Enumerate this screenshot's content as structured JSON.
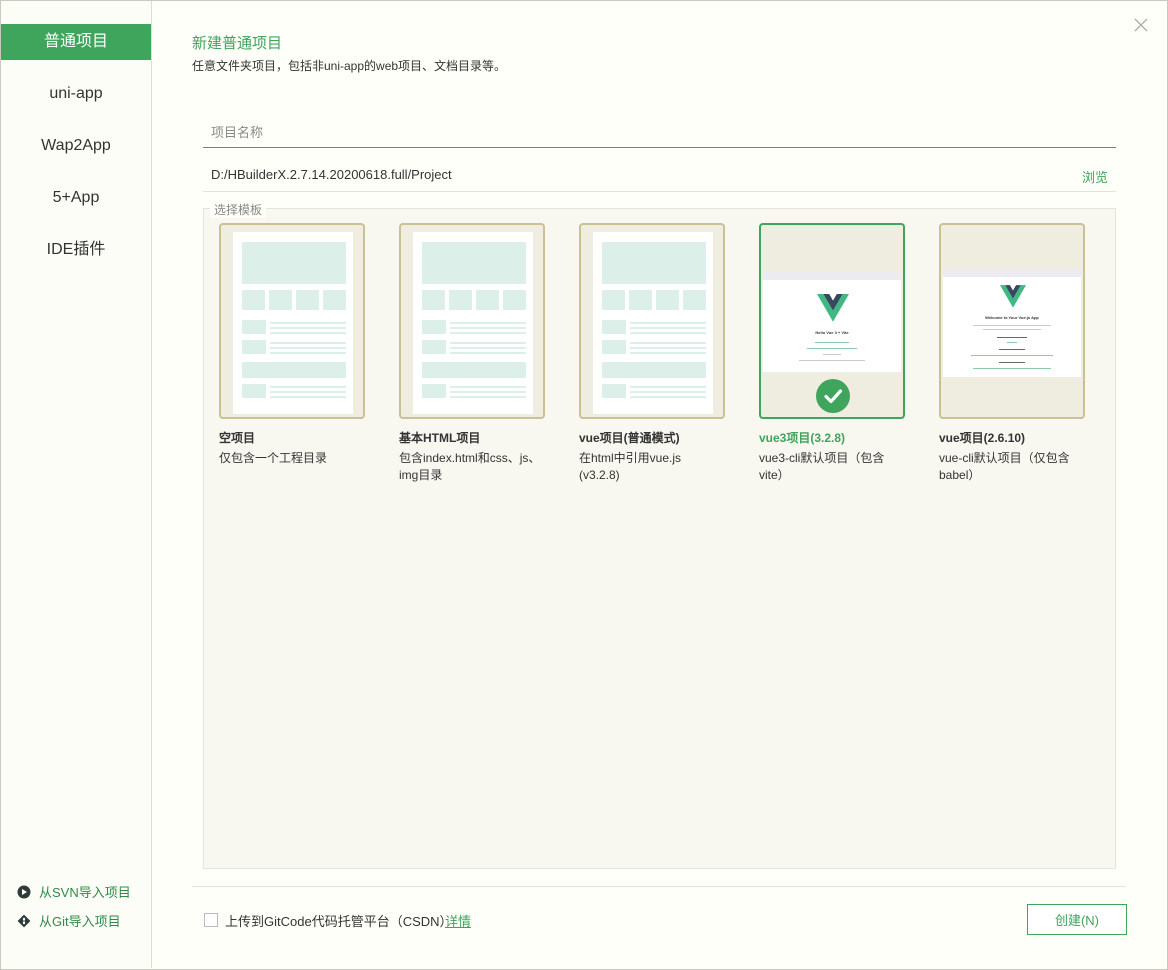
{
  "sidebar": {
    "items": [
      {
        "label": "普通项目"
      },
      {
        "label": "uni-app"
      },
      {
        "label": "Wap2App"
      },
      {
        "label": "5+App"
      },
      {
        "label": "IDE插件"
      }
    ],
    "import_svn": "从SVN导入项目",
    "import_git": "从Git导入项目"
  },
  "header": {
    "title": "新建普通项目",
    "subtitle": "任意文件夹项目，包括非uni-app的web项目、文档目录等。"
  },
  "form": {
    "name_placeholder": "项目名称",
    "name_value": "",
    "path": "D:/HBuilderX.2.7.14.20200618.full/Project",
    "browse_label": "浏览"
  },
  "templates": {
    "legend": "选择模板",
    "cards": [
      {
        "name": "空项目",
        "desc": "仅包含一个工程目录"
      },
      {
        "name": "基本HTML项目",
        "desc": "包含index.html和css、js、img目录"
      },
      {
        "name": "vue项目(普通模式)",
        "desc": "在html中引用vue.js (v3.2.8)"
      },
      {
        "name": "vue3项目(3.2.8)",
        "desc": "vue3-cli默认项目（包含vite）",
        "preview_title": "Hello Vue 3 + Vite"
      },
      {
        "name": "vue项目(2.6.10)",
        "desc": "vue-cli默认项目（仅包含babel）",
        "preview_title": "Welcome to Your Vue.js App"
      }
    ],
    "selected_index": 3
  },
  "footer": {
    "upload_label": "上传到GitCode代码托管平台（CSDN）",
    "detail_link": "详情",
    "create_button": "创建(N)"
  },
  "colors": {
    "accent": "#3fa45c",
    "card_border": "#cbbf94"
  }
}
